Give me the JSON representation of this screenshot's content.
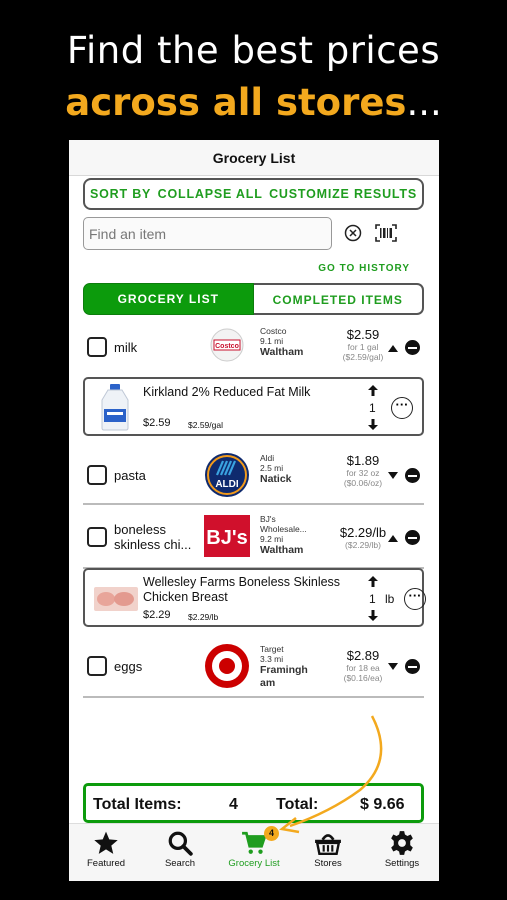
{
  "headline": {
    "line1": "Find the best prices",
    "line2": "across all stores",
    "line2_suffix": "..."
  },
  "app": {
    "title": "Grocery List"
  },
  "toolbar": {
    "sort_by": "SORT BY",
    "collapse_all": "COLLAPSE ALL",
    "customize_results": "CUSTOMIZE RESULTS"
  },
  "search": {
    "placeholder": "Find an item"
  },
  "history_link": "GO TO HISTORY",
  "tabs": {
    "grocery_list": "GROCERY LIST",
    "completed_items": "COMPLETED ITEMS"
  },
  "items": [
    {
      "name": "milk",
      "store": "Costco",
      "distance": "9.1 mi",
      "city": "Waltham",
      "price": "$2.59",
      "size": "for 1 gal",
      "unit_price": "($2.59/gal)",
      "expanded": true,
      "detail": {
        "product": "Kirkland 2% Reduced Fat Milk",
        "price": "$2.59",
        "unit": "$2.59/gal",
        "qty": "1",
        "qty_unit": ""
      }
    },
    {
      "name": "pasta",
      "store": "Aldi",
      "distance": "2.5 mi",
      "city": "Natick",
      "price": "$1.89",
      "size": "for 32 oz",
      "unit_price": "($0.06/oz)",
      "expanded": false
    },
    {
      "name_line1": "boneless",
      "name_line2": "skinless chi...",
      "store": "BJ's",
      "store_line2": "Wholesale...",
      "distance": "9.2 mi",
      "city": "Waltham",
      "price": "$2.29/lb",
      "unit_price": "($2.29/lb)",
      "expanded": true,
      "detail": {
        "product_line1": "Wellesley Farms Boneless Skinless",
        "product_line2": "Chicken Breast",
        "price": "$2.29",
        "unit": "$2.29/lb",
        "qty": "1",
        "qty_unit": "lb"
      }
    },
    {
      "name": "eggs",
      "store": "Target",
      "distance": "3.3 mi",
      "city_line1": "Framingh",
      "city_line2": "am",
      "price": "$2.89",
      "size": "for 18 ea",
      "unit_price": "($0.16/ea)",
      "expanded": false
    }
  ],
  "logos": {
    "costco": "Costco",
    "aldi": "ALDI",
    "bjs": "BJ's"
  },
  "totals": {
    "items_label": "Total Items:",
    "items_count": "4",
    "total_label": "Total:",
    "total_value": "$ 9.66"
  },
  "tabbar": {
    "featured": "Featured",
    "search": "Search",
    "grocery_list": "Grocery List",
    "stores": "Stores",
    "settings": "Settings",
    "cart_badge": "4"
  },
  "colors": {
    "accent_green": "#0c9b0c",
    "headline_orange": "#F3A91E",
    "background": "#000000"
  },
  "icons": [
    "clear-icon",
    "barcode-icon",
    "checkbox-icon",
    "chevron-up-icon",
    "chevron-down-icon",
    "minus-circle-icon",
    "arrow-up-icon",
    "arrow-down-icon",
    "more-options-icon",
    "star-icon",
    "search-icon",
    "cart-icon",
    "basket-icon",
    "gear-icon"
  ]
}
